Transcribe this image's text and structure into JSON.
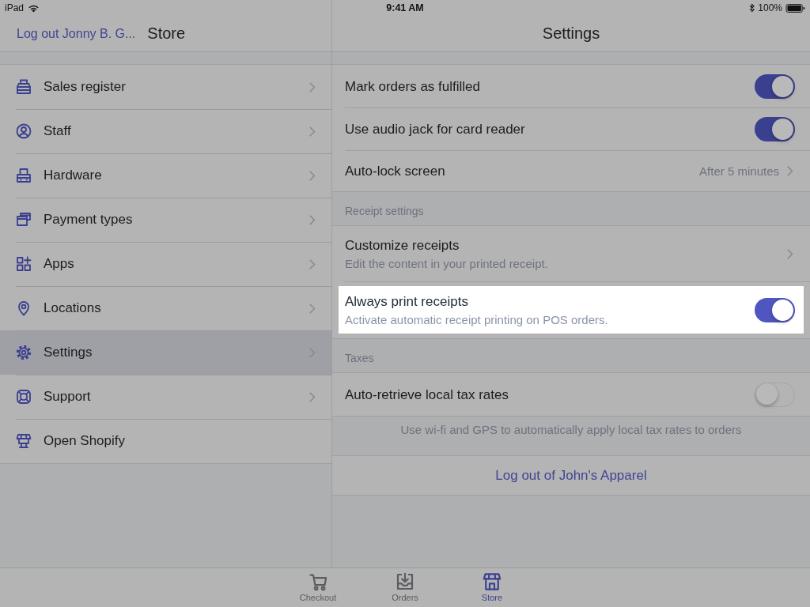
{
  "status_bar": {
    "device": "iPad",
    "time": "9:41 AM",
    "battery": "100%"
  },
  "master": {
    "back_link": "Log out Jonny B. G...",
    "title": "Store",
    "items": [
      {
        "label": "Sales register",
        "kind": "nav",
        "selected": false
      },
      {
        "label": "Staff",
        "kind": "nav",
        "selected": false
      },
      {
        "label": "Hardware",
        "kind": "nav",
        "selected": false
      },
      {
        "label": "Payment types",
        "kind": "nav",
        "selected": false
      },
      {
        "label": "Apps",
        "kind": "nav",
        "selected": false
      },
      {
        "label": "Locations",
        "kind": "nav",
        "selected": false
      },
      {
        "label": "Settings",
        "kind": "nav",
        "selected": true
      },
      {
        "label": "Support",
        "kind": "nav",
        "selected": false
      },
      {
        "label": "Open Shopify",
        "kind": "action",
        "selected": false
      }
    ]
  },
  "detail": {
    "title": "Settings",
    "sections": [
      {
        "rows": [
          {
            "kind": "toggle",
            "label": "Mark orders as fulfilled",
            "on": true,
            "highlighted": false
          },
          {
            "kind": "toggle",
            "label": "Use audio jack for card reader",
            "on": true,
            "highlighted": false
          },
          {
            "kind": "value",
            "label": "Auto-lock screen",
            "value": "After 5 minutes",
            "highlighted": false
          }
        ]
      },
      {
        "header": "Receipt settings",
        "rows": [
          {
            "kind": "link",
            "label": "Customize receipts",
            "subtitle": "Edit the content in your printed receipt.",
            "highlighted": false
          },
          {
            "kind": "toggle",
            "label": "Always print receipts",
            "subtitle": "Activate automatic receipt printing on POS orders.",
            "on": true,
            "highlighted": true
          }
        ]
      },
      {
        "header": "Taxes",
        "rows": [
          {
            "kind": "toggle",
            "label": "Auto-retrieve local tax rates",
            "on": false,
            "highlighted": false
          }
        ],
        "footer": "Use wi-fi and GPS to automatically apply local tax rates to orders"
      },
      {
        "rows": [
          {
            "kind": "button",
            "label": "Log out of John's Apparel",
            "highlighted": false
          }
        ]
      }
    ]
  },
  "tab_bar": {
    "tabs": [
      {
        "label": "Checkout",
        "selected": false
      },
      {
        "label": "Orders",
        "selected": false
      },
      {
        "label": "Store",
        "selected": true
      }
    ]
  }
}
